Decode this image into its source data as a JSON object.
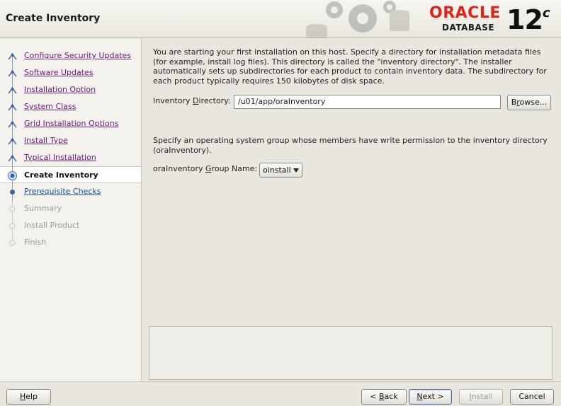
{
  "header": {
    "title": "Create Inventory",
    "brand": "ORACLE",
    "product": "DATABASE",
    "version": "12",
    "version_suffix": "c",
    "brand_color": "#e2231a"
  },
  "sidebar": {
    "steps": [
      {
        "label": "Configure Security Updates",
        "state": "done"
      },
      {
        "label": "Software Updates",
        "state": "done"
      },
      {
        "label": "Installation Option",
        "state": "done"
      },
      {
        "label": "System Class",
        "state": "done"
      },
      {
        "label": "Grid Installation Options",
        "state": "done"
      },
      {
        "label": "Install Type",
        "state": "done"
      },
      {
        "label": "Typical Installation",
        "state": "done"
      },
      {
        "label": "Create Inventory",
        "state": "active"
      },
      {
        "label": "Prerequisite Checks",
        "state": "next"
      },
      {
        "label": "Summary",
        "state": "pending"
      },
      {
        "label": "Install Product",
        "state": "pending"
      },
      {
        "label": "Finish",
        "state": "pending"
      }
    ]
  },
  "main": {
    "intro_text": "You are starting your first installation on this host. Specify a directory for installation metadata files (for example, install log files). This directory is called the \"inventory directory\". The installer automatically sets up subdirectories for each product to contain inventory data. The subdirectory for each product typically requires 150 kilobytes of disk space.",
    "inventory_dir_label_pre": "Inventory ",
    "inventory_dir_label_mnemonic": "D",
    "inventory_dir_label_post": "irectory:",
    "inventory_dir_value": "/u01/app/oraInventory",
    "browse_label_pre": "B",
    "browse_label_mnemonic": "r",
    "browse_label_post": "owse...",
    "group_text": "Specify an operating system group whose members have write permission to the inventory directory (oraInventory).",
    "group_label_pre": "oraInventory ",
    "group_label_mnemonic": "G",
    "group_label_post": "roup Name:",
    "group_value": "oinstall"
  },
  "footer": {
    "help_mnemonic": "H",
    "help_rest": "elp",
    "back_pre": "< ",
    "back_mnemonic": "B",
    "back_rest": "ack",
    "next_mnemonic": "N",
    "next_rest": "ext >",
    "install_mnemonic": "I",
    "install_rest": "nstall",
    "cancel_label": "Cancel"
  }
}
